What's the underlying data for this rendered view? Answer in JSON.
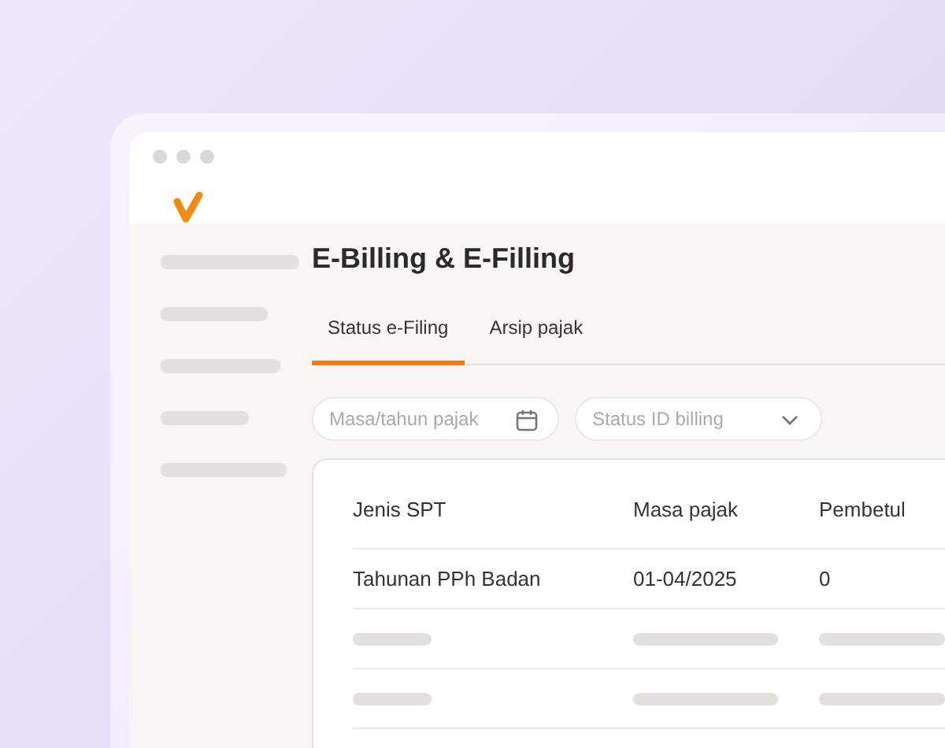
{
  "page": {
    "title": "E-Billing & E-Filling"
  },
  "tabs": [
    {
      "label": "Status e-Filing",
      "selected": true
    },
    {
      "label": "Arsip pajak",
      "selected": false
    }
  ],
  "filters": [
    {
      "kind": "date",
      "placeholder": "Masa/tahun pajak"
    },
    {
      "kind": "dropdown",
      "placeholder": "Status ID billing"
    }
  ],
  "table": {
    "columns": [
      "Jenis SPT",
      "Masa pajak",
      "Pembetul"
    ],
    "rows": [
      [
        "Tahunan PPh Badan",
        "01-04/2025",
        "0"
      ]
    ]
  }
}
